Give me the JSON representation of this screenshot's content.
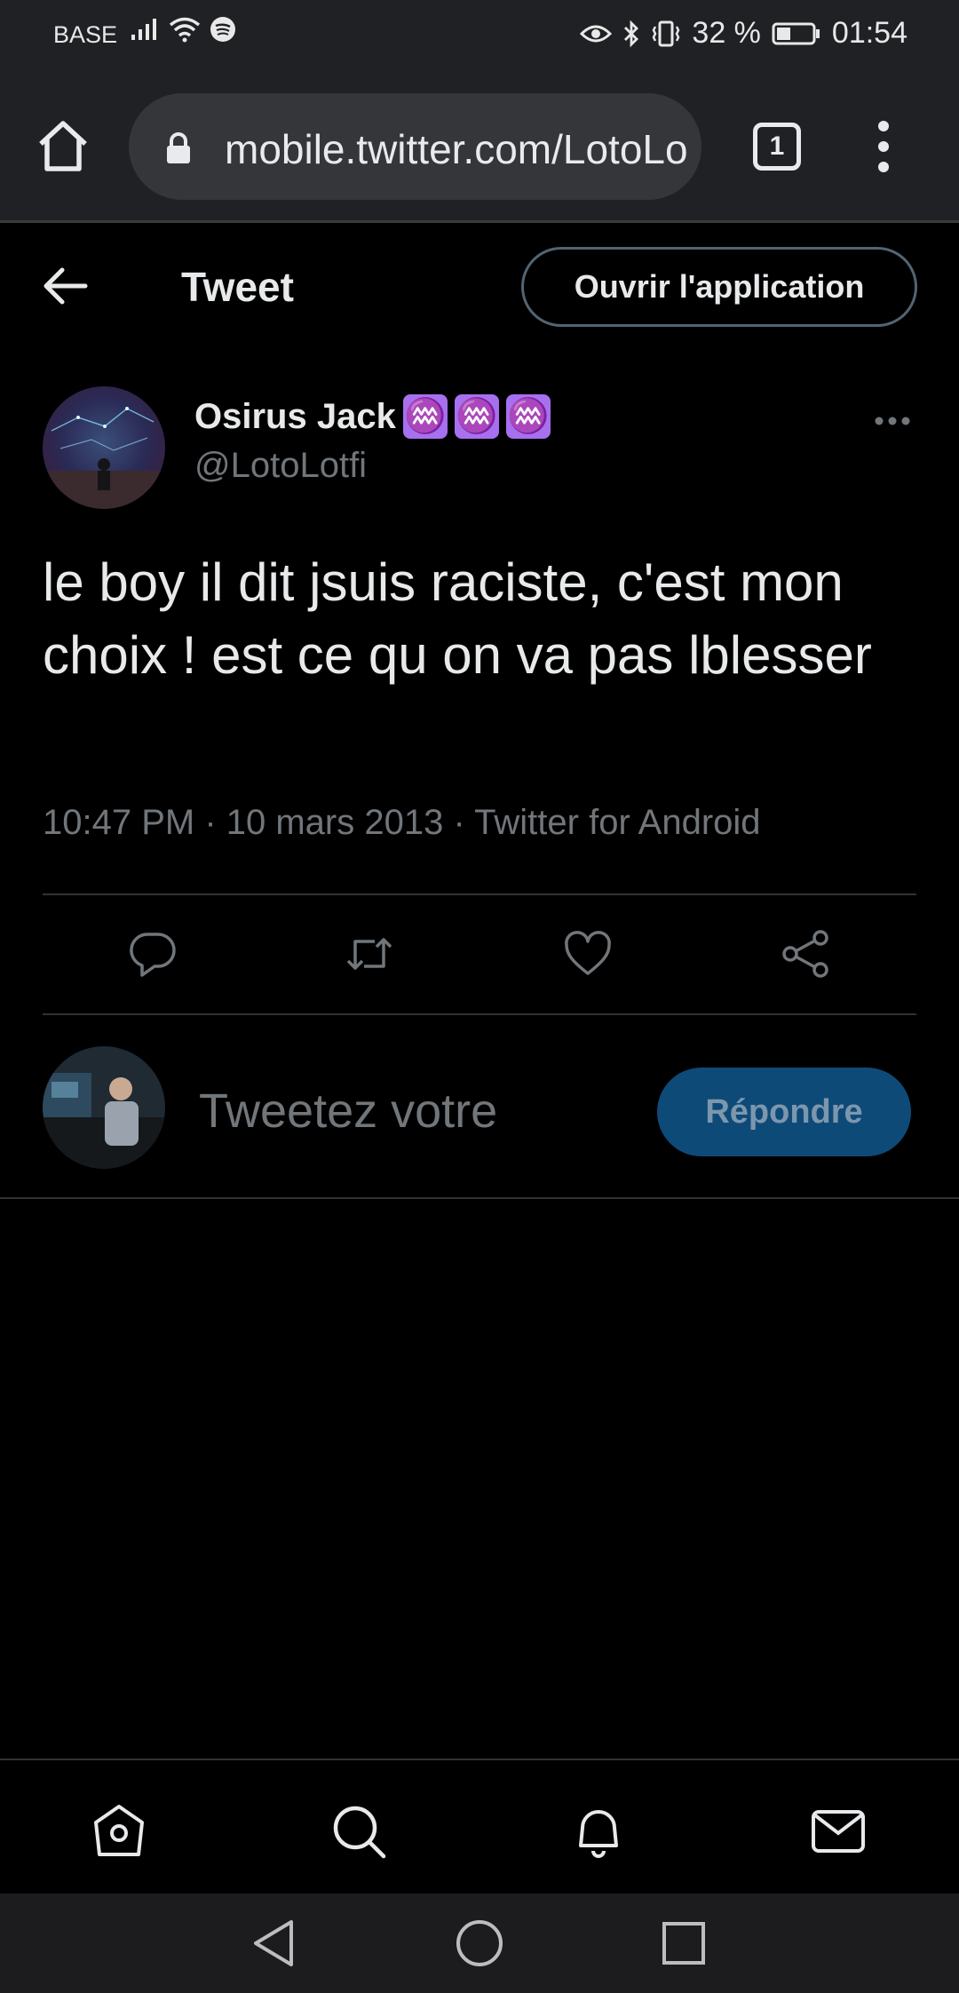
{
  "status_bar": {
    "carrier": "BASE",
    "battery_percent": "32 %",
    "time": "01:54",
    "icons": [
      "signal-icon",
      "wifi-icon",
      "spotify-icon",
      "eye-icon",
      "bluetooth-icon",
      "vibrate-icon",
      "battery-icon"
    ]
  },
  "browser": {
    "url": "mobile.twitter.com/LotoLotfi",
    "tab_count": "1",
    "icons": [
      "home-icon",
      "lock-icon",
      "tabs-icon",
      "menu-icon"
    ]
  },
  "header": {
    "title": "Tweet",
    "open_app_label": "Ouvrir l'application"
  },
  "tweet": {
    "author_name": "Osirus Jack",
    "badges": [
      "♒",
      "♒",
      "♒"
    ],
    "handle": "@LotoLotfi",
    "text": "le boy il dit jsuis raciste, c'est mon choix ! est ce qu on va pas lblesser",
    "meta": "10:47 PM · 10 mars 2013 · Twitter for Android"
  },
  "actions": [
    "reply-icon",
    "retweet-icon",
    "like-icon",
    "share-icon"
  ],
  "reply": {
    "placeholder": "Tweetez votre",
    "button_label": "Répondre"
  },
  "bottom_nav": [
    "home-icon",
    "search-icon",
    "notifications-icon",
    "messages-icon"
  ],
  "colors": {
    "background": "#000000",
    "text": "#e7e9ea",
    "secondary_text": "#71767b",
    "reply_button": "#0e4a78",
    "badge": "#a770ef",
    "browser_chrome": "#202124"
  }
}
